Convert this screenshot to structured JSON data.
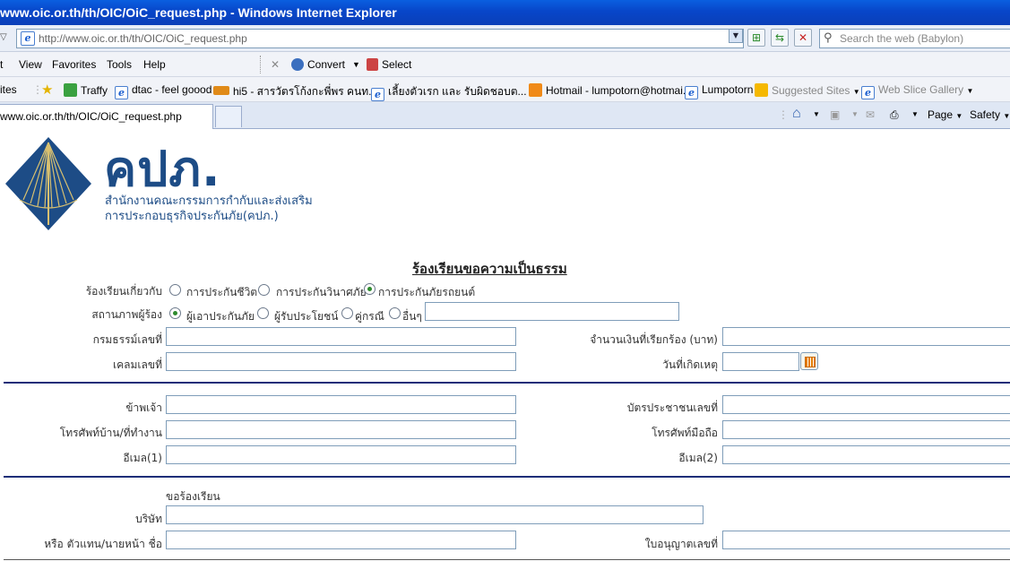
{
  "window": {
    "title": "www.oic.or.th/th/OIC/OiC_request.php - Windows Internet Explorer"
  },
  "address_bar": {
    "url": "http://www.oic.or.th/th/OIC/OiC_request.php",
    "search_placeholder": "Search the web (Babylon)"
  },
  "menu": {
    "items": [
      "t",
      "View",
      "Favorites",
      "Tools",
      "Help"
    ],
    "convert_label": "Convert",
    "select_label": "Select"
  },
  "favorites_bar": {
    "label": "ites",
    "items": [
      "Traffy",
      "dtac - feel goood",
      "hi5 - สารวัตรโก้งกะพี่พร คนท...",
      "เลี้ยงตัวเรก และ รับผิดชอบต...",
      "Hotmail - lumpotorn@hotmai...",
      "Lumpotorn",
      "Suggested Sites",
      "Web Slice Gallery"
    ]
  },
  "tabs": {
    "active_label": "www.oic.or.th/th/OIC/OiC_request.php",
    "page_label": "Page",
    "safety_label": "Safety"
  },
  "header": {
    "logo_text": "คปภ.",
    "subtitle_line1": "สำนักงานคณะกรรมการกำกับและส่งเสริม",
    "subtitle_line2": "การประกอบธุรกิจประกันภัย(คปภ.)"
  },
  "form": {
    "title": "ร้องเรียนขอความเป็นธรรม",
    "complaint_about": {
      "label": "ร้องเรียนเกี่ยวกับ",
      "options": [
        "การประกันชีวิต",
        "การประกันวินาศภัย",
        "การประกันภัยรถยนต์"
      ],
      "selected": "การประกันภัยรถยนต์"
    },
    "complainant_status": {
      "label": "สถานภาพผู้ร้อง",
      "options": [
        "ผู้เอาประกันภัย",
        "ผู้รับประโยชน์",
        "คู่กรณี",
        "อื่นๆ"
      ],
      "selected": "ผู้เอาประกันภัย"
    },
    "policy_no_label": "กรมธรรม์เลขที่",
    "claim_no_label": "เคลมเลขที่",
    "claim_amount_label": "จำนวนเงินที่เรียกร้อง (บาท)",
    "incident_date_label": "วันที่เกิดเหตุ",
    "name_label": "ข้าพเจ้า",
    "id_card_label": "บัตรประชาชนเลขที่",
    "home_phone_label": "โทรศัพท์บ้าน/ที่ทำงาน",
    "mobile_label": "โทรศัพท์มือถือ",
    "email1_label": "อีเมล(1)",
    "email2_label": "อีเมล(2)",
    "complain_heading": "ขอร้องเรียน",
    "company_label": "บริษัท",
    "agent_label": "หรือ ตัวแทน/นายหน้า ชื่อ",
    "license_label": "ใบอนุญาตเลขที่"
  }
}
